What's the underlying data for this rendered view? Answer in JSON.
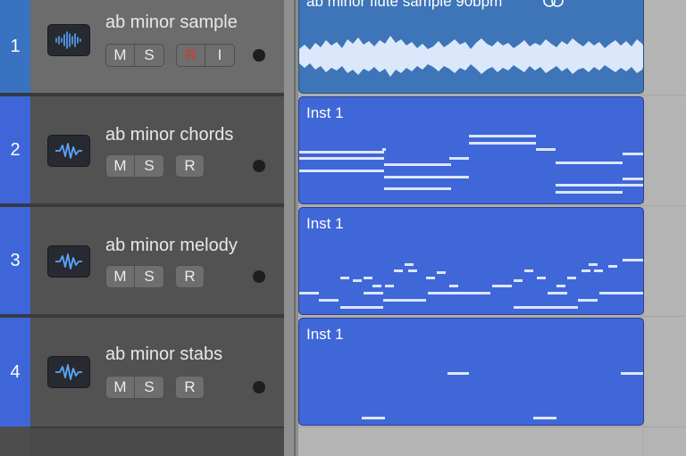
{
  "tracks": [
    {
      "number": "1",
      "name": "ab minor sample",
      "buttons": [
        "M",
        "S",
        "R",
        "I"
      ],
      "icon": "audio-waveform-icon"
    },
    {
      "number": "2",
      "name": "ab minor chords",
      "buttons": [
        "M",
        "S",
        "R"
      ],
      "icon": "software-instrument-icon"
    },
    {
      "number": "3",
      "name": "ab minor melody",
      "buttons": [
        "M",
        "S",
        "R"
      ],
      "icon": "software-instrument-icon"
    },
    {
      "number": "4",
      "name": "ab minor stabs",
      "buttons": [
        "M",
        "S",
        "R"
      ],
      "icon": "software-instrument-icon"
    }
  ],
  "regions": [
    {
      "label": "ab minor flute sample 90bpm",
      "loop_icon": "loop-icon"
    },
    {
      "label": "Inst 1"
    },
    {
      "label": "Inst 1"
    },
    {
      "label": "Inst 1"
    }
  ],
  "colors": {
    "track_number_selected": "#3972c0",
    "track_number": "#3e66d8",
    "audio_region": "#3d75b8",
    "midi_region": "#4067d8",
    "header_selected": "#6c6c6c",
    "header": "#525252",
    "record_active": "#e0332e"
  }
}
